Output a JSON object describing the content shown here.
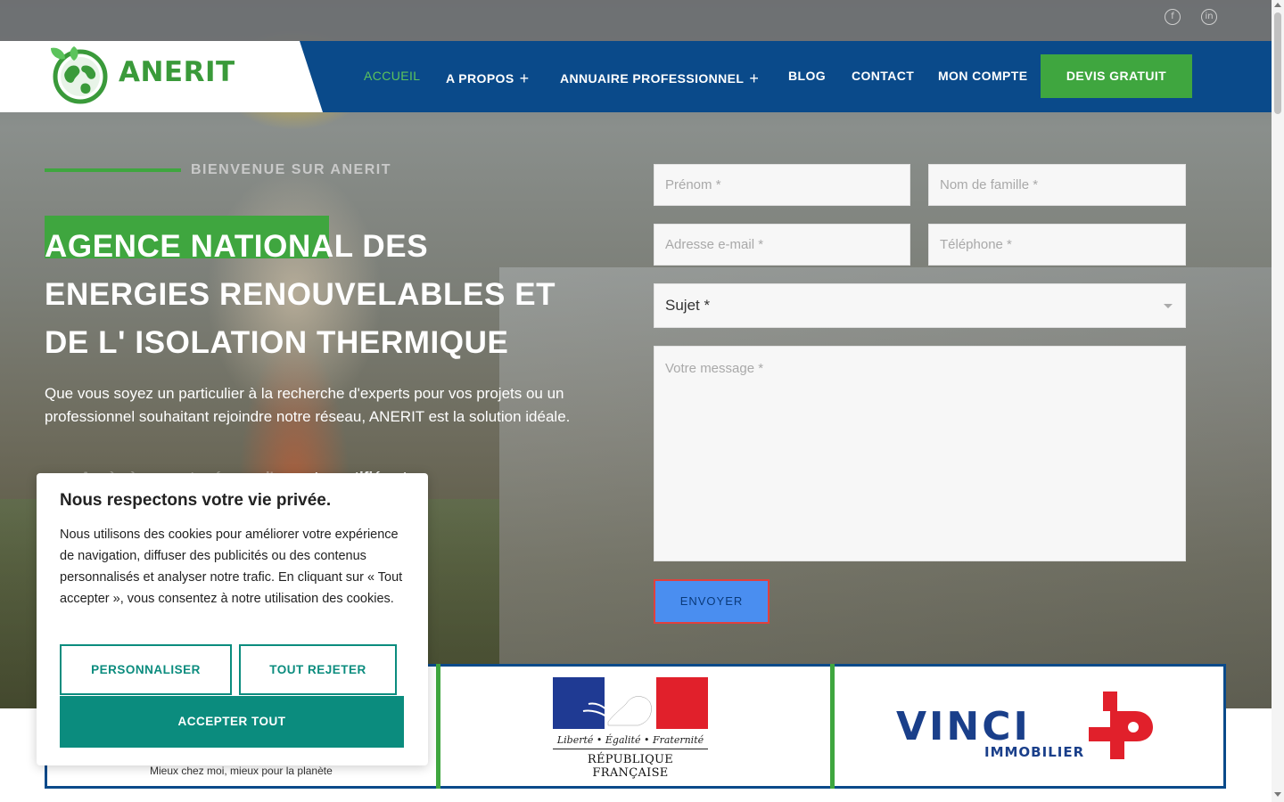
{
  "topbar": {
    "phone_icon": "phone-icon",
    "mail_icon": "mail-icon",
    "social": [
      {
        "icon": "facebook-icon",
        "glyph": "f"
      },
      {
        "icon": "linkedin-icon",
        "glyph": "in"
      }
    ]
  },
  "brand": {
    "name": "ANERIT",
    "logo_icon": "globe-leaf-icon"
  },
  "nav": {
    "items": [
      {
        "label": "ACCUEIL",
        "active": true
      },
      {
        "label": "A PROPOS",
        "has_submenu": true
      },
      {
        "label": "ANNUAIRE PROFESSIONNEL",
        "has_submenu": true
      },
      {
        "label": "BLOG"
      },
      {
        "label": "CONTACT"
      },
      {
        "label": "MON COMPTE"
      }
    ],
    "cta_label": "DEVIS GRATUIT"
  },
  "hero": {
    "eyebrow": "BIENVENUE SUR ANERIT",
    "title_line1": "AGENCE NATIONAL DES",
    "title_line2": "ENERGIES RENOUVELABLES ET",
    "title_line3": "DE L' ISOLATION THERMIQUE",
    "description": "Que vous soyez un particulier à la recherche d'experts pour vos projets ou un professionnel souhaitant rejoindre notre réseau, ANERIT est la solution idéale.",
    "bullet_visible": "xperts certifiés et"
  },
  "form": {
    "first_name_placeholder": "Prénom *",
    "last_name_placeholder": "Nom de famille *",
    "email_placeholder": "Adresse e-mail *",
    "phone_placeholder": "Téléphone *",
    "subject_selected": "Sujet *",
    "message_placeholder": "Votre message *",
    "submit_label": "ENVOYER"
  },
  "partners": {
    "tagline": "Mieux chez moi, mieux pour la planète",
    "rf_motto": "Liberté • Égalité • Fraternité",
    "rf_name": "RÉPUBLIQUE FRANÇAISE",
    "vinci_name": "VINCI",
    "vinci_sub": "IMMOBILIER"
  },
  "cookie": {
    "title": "Nous respectons votre vie privée.",
    "text": "Nous utilisons des cookies pour améliorer votre expérience de navigation, diffuser des publicités ou des contenus personnalisés et analyser notre trafic. En cliquant sur « Tout accepter », vous consentez à notre utilisation des cookies.",
    "customize_label": "PERSONNALISER",
    "reject_label": "TOUT REJETER",
    "accept_label": "ACCEPTER TOUT"
  },
  "colors": {
    "brand_green": "#3fa63f",
    "nav_blue": "#0a4a8a",
    "cookie_teal": "#0b8c7e",
    "send_blue": "#4a8ef0"
  }
}
